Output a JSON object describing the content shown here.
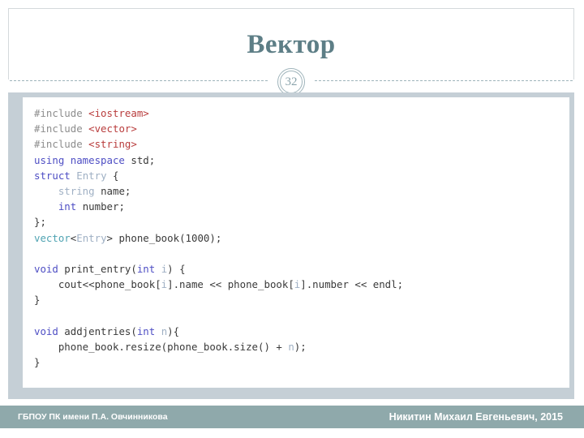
{
  "slide": {
    "title": "Вектор",
    "number": "32",
    "accent_color": "#5d7e86",
    "rule_color": "#9fb4bb",
    "code_frame_color": "#c5cfd6",
    "footer_color": "#8fa9ab"
  },
  "code": {
    "language": "cpp",
    "lines": [
      [
        {
          "t": "#include ",
          "c": "tok-pre"
        },
        {
          "t": "<iostream>",
          "c": "tok-hdr"
        }
      ],
      [
        {
          "t": "#include ",
          "c": "tok-pre"
        },
        {
          "t": "<vector>",
          "c": "tok-hdr"
        }
      ],
      [
        {
          "t": "#include ",
          "c": "tok-pre"
        },
        {
          "t": "<string>",
          "c": "tok-hdr"
        }
      ],
      [
        {
          "t": "using namespace",
          "c": "tok-kw"
        },
        {
          "t": " std;",
          "c": "tok-plain"
        }
      ],
      [
        {
          "t": "struct",
          "c": "tok-kw"
        },
        {
          "t": " ",
          "c": "tok-plain"
        },
        {
          "t": "Entry",
          "c": "tok-type"
        },
        {
          "t": " {",
          "c": "tok-plain"
        }
      ],
      [
        {
          "t": "    ",
          "c": "tok-plain"
        },
        {
          "t": "string",
          "c": "tok-type"
        },
        {
          "t": " name;",
          "c": "tok-plain"
        }
      ],
      [
        {
          "t": "    ",
          "c": "tok-plain"
        },
        {
          "t": "int",
          "c": "tok-kw"
        },
        {
          "t": " number;",
          "c": "tok-plain"
        }
      ],
      [
        {
          "t": "};",
          "c": "tok-plain"
        }
      ],
      [
        {
          "t": "vector",
          "c": "tok-vec"
        },
        {
          "t": "<",
          "c": "tok-plain"
        },
        {
          "t": "Entry",
          "c": "tok-type"
        },
        {
          "t": "> phone_book(1000);",
          "c": "tok-plain"
        }
      ],
      [
        {
          "t": "",
          "c": "tok-plain"
        }
      ],
      [
        {
          "t": "void",
          "c": "tok-kw"
        },
        {
          "t": " print_entry(",
          "c": "tok-plain"
        },
        {
          "t": "int",
          "c": "tok-kw"
        },
        {
          "t": " ",
          "c": "tok-plain"
        },
        {
          "t": "i",
          "c": "tok-var"
        },
        {
          "t": ") {",
          "c": "tok-plain"
        }
      ],
      [
        {
          "t": "    cout<<phone_book[",
          "c": "tok-plain"
        },
        {
          "t": "i",
          "c": "tok-var"
        },
        {
          "t": "].name << phone_book[",
          "c": "tok-plain"
        },
        {
          "t": "i",
          "c": "tok-var"
        },
        {
          "t": "].number << endl;",
          "c": "tok-plain"
        }
      ],
      [
        {
          "t": "}",
          "c": "tok-plain"
        }
      ],
      [
        {
          "t": "",
          "c": "tok-plain"
        }
      ],
      [
        {
          "t": "void",
          "c": "tok-kw"
        },
        {
          "t": " addjentries(",
          "c": "tok-plain"
        },
        {
          "t": "int",
          "c": "tok-kw"
        },
        {
          "t": " ",
          "c": "tok-plain"
        },
        {
          "t": "n",
          "c": "tok-var"
        },
        {
          "t": "){",
          "c": "tok-plain"
        }
      ],
      [
        {
          "t": "    phone_book.resize(phone_book.size() + ",
          "c": "tok-plain"
        },
        {
          "t": "n",
          "c": "tok-var"
        },
        {
          "t": ");",
          "c": "tok-plain"
        }
      ],
      [
        {
          "t": "}",
          "c": "tok-plain"
        }
      ]
    ]
  },
  "footer": {
    "left": "ГБПОУ ПК имени П.А. Овчинникова",
    "right": "Никитин Михаил Евгеньевич, 2015"
  }
}
